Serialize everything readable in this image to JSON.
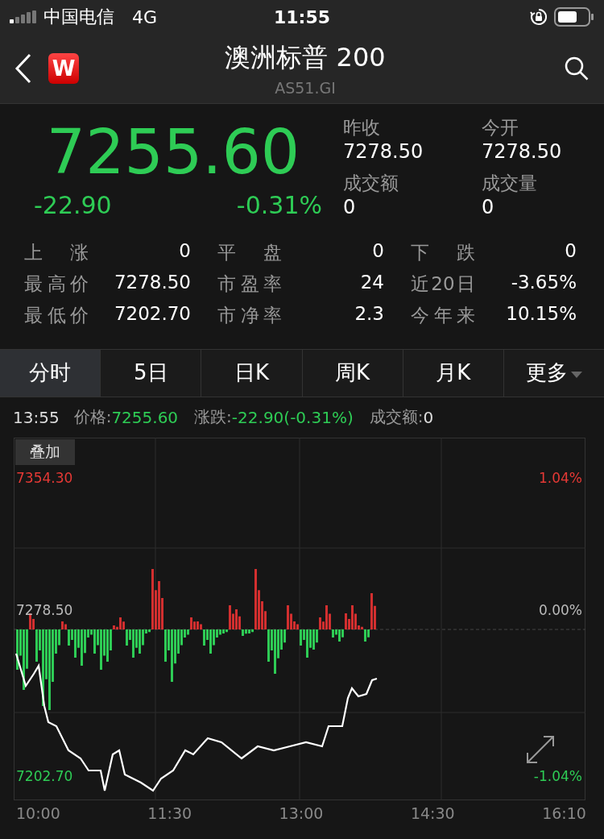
{
  "status_bar": {
    "carrier": "中国电信",
    "network": "4G",
    "time": "11:55"
  },
  "header": {
    "logo": "W",
    "title": "澳洲标普 200",
    "code": "AS51.GI"
  },
  "quote": {
    "price": "7255.60",
    "change": "-22.90",
    "change_pct": "-0.31%",
    "color": "#2ecc55",
    "facts": [
      {
        "label": "昨收",
        "value": "7278.50"
      },
      {
        "label": "今开",
        "value": "7278.50"
      },
      {
        "label": "成交额",
        "value": "0"
      },
      {
        "label": "成交量",
        "value": "0"
      }
    ]
  },
  "stats": [
    {
      "label": "上涨",
      "value": "0"
    },
    {
      "label": "平盘",
      "value": "0"
    },
    {
      "label": "下跌",
      "value": "0"
    },
    {
      "label": "最高价",
      "value": "7278.50"
    },
    {
      "label": "市盈率",
      "value": "24"
    },
    {
      "label": "近20日",
      "value": "-3.65%"
    },
    {
      "label": "最低价",
      "value": "7202.70"
    },
    {
      "label": "市净率",
      "value": "2.3"
    },
    {
      "label": "今年来",
      "value": "10.15%"
    }
  ],
  "tabs": [
    {
      "label": "分时",
      "selected": true,
      "dropdown": false
    },
    {
      "label": "5日",
      "selected": false,
      "dropdown": false
    },
    {
      "label": "日K",
      "selected": false,
      "dropdown": false
    },
    {
      "label": "周K",
      "selected": false,
      "dropdown": false
    },
    {
      "label": "月K",
      "selected": false,
      "dropdown": false
    },
    {
      "label": "更多",
      "selected": false,
      "dropdown": true
    }
  ],
  "info_line": {
    "time": "13:55",
    "items": [
      {
        "label": "价格:",
        "value": "7255.60",
        "color": "#2ecc55"
      },
      {
        "label": "涨跌:",
        "value": "-22.90(-0.31%)",
        "color": "#2ecc55"
      },
      {
        "label": "成交额:",
        "value": "0",
        "color": "#dddddd"
      }
    ]
  },
  "chart": {
    "overlay_button": "叠加",
    "left_labels": [
      {
        "text": "7354.30",
        "color": "#e53935"
      },
      {
        "text": "7278.50",
        "color": "#bbbbbb"
      },
      {
        "text": "7202.70",
        "color": "#2ecc55"
      }
    ],
    "right_labels": [
      {
        "text": "1.04%",
        "color": "#e53935"
      },
      {
        "text": "0.00%",
        "color": "#bbbbbb"
      },
      {
        "text": "-1.04%",
        "color": "#2ecc55"
      }
    ],
    "x_labels": [
      "10:00",
      "11:30",
      "13:00",
      "14:30",
      "16:10"
    ]
  }
}
